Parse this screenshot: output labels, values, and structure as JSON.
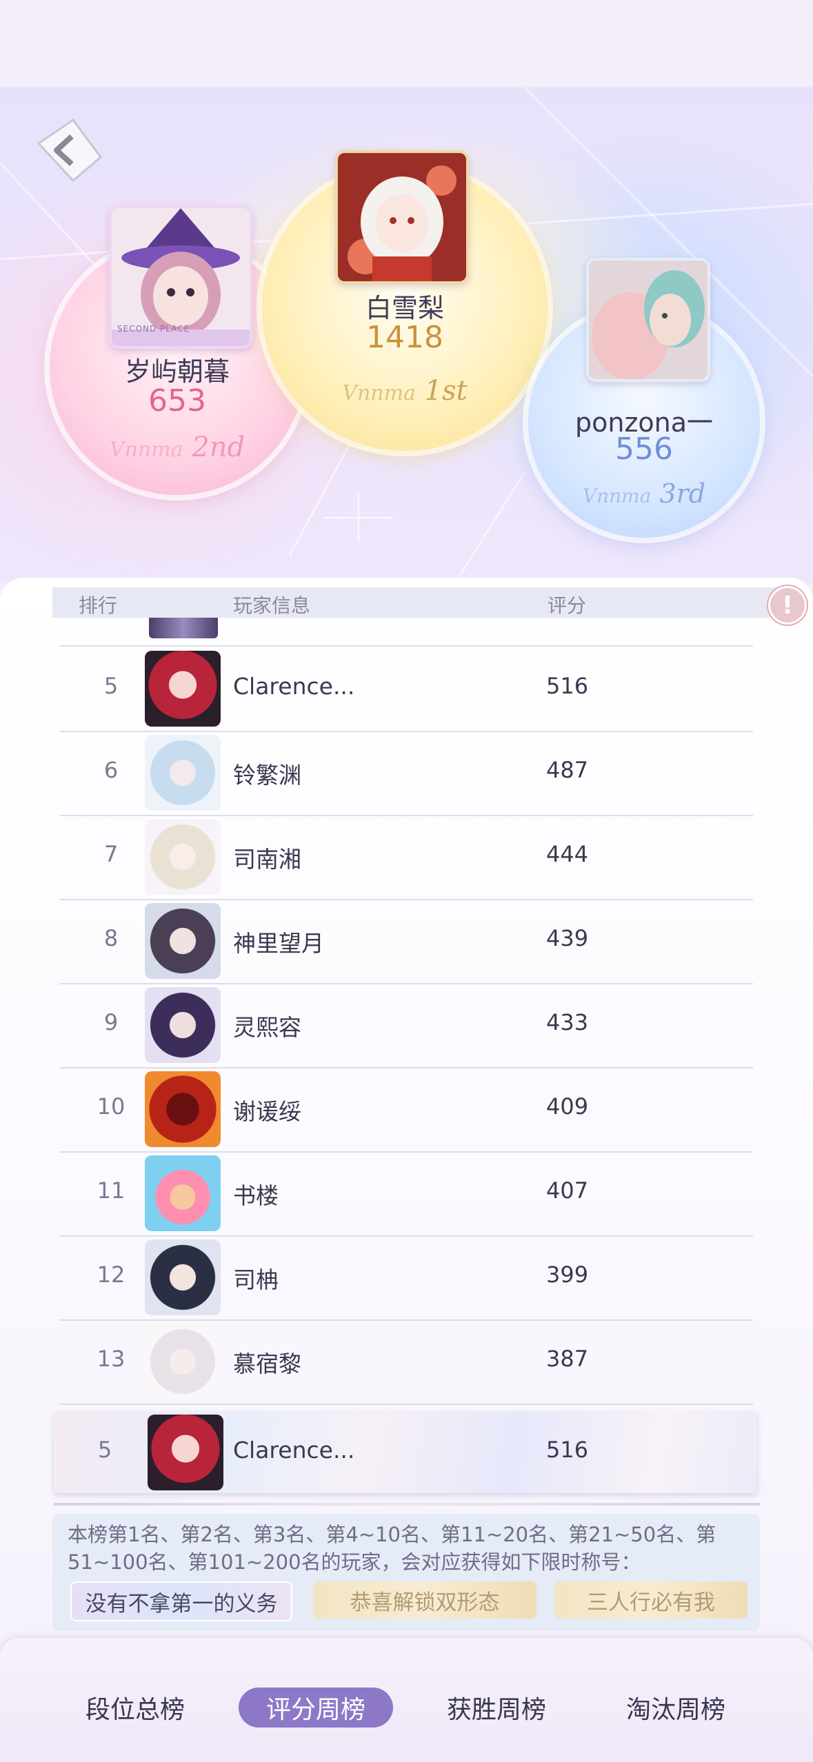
{
  "header": {
    "back_icon": "back-arrow-icon"
  },
  "podium": [
    {
      "place": 2,
      "name": "岁屿朝暮",
      "score": "653",
      "rank_text": "2nd",
      "script_text": "Vnnma"
    },
    {
      "place": 1,
      "name": "白雪梨",
      "score": "1418",
      "rank_text": "1st",
      "script_text": "Vnnma"
    },
    {
      "place": 3,
      "name": "ponzona一",
      "score": "556",
      "rank_text": "3rd",
      "script_text": "Vnnma"
    }
  ],
  "podium_avatar_badge": "SECOND PLACE",
  "table": {
    "columns": {
      "rank": "排行",
      "player": "玩家信息",
      "score": "评分"
    },
    "info_icon": "!",
    "rows": [
      {
        "rank": "5",
        "name": "Clarence...",
        "score": "516"
      },
      {
        "rank": "6",
        "name": "铃繁渊",
        "score": "487"
      },
      {
        "rank": "7",
        "name": "司南湘",
        "score": "444"
      },
      {
        "rank": "8",
        "name": "神里望月",
        "score": "439"
      },
      {
        "rank": "9",
        "name": "灵熙容",
        "score": "433"
      },
      {
        "rank": "10",
        "name": "谢谖绥",
        "score": "409"
      },
      {
        "rank": "11",
        "name": "书楼",
        "score": "407"
      },
      {
        "rank": "12",
        "name": "司柟",
        "score": "399"
      },
      {
        "rank": "13",
        "name": "慕宿黎",
        "score": "387"
      }
    ]
  },
  "my_rank": {
    "rank": "5",
    "name": "Clarence...",
    "score": "516"
  },
  "rewards": {
    "description": "本榜第1名、第2名、第3名、第4~10名、第11~20名、第21~50名、第51~100名、第101~200名的玩家，会对应获得如下限时称号：",
    "titles": [
      "没有不拿第一的义务",
      "恭喜解锁双形态",
      "三人行必有我"
    ]
  },
  "tabs": [
    {
      "label": "段位总榜",
      "active": false
    },
    {
      "label": "评分周榜",
      "active": true
    },
    {
      "label": "获胜周榜",
      "active": false
    },
    {
      "label": "淘汰周榜",
      "active": false
    }
  ],
  "colors": {
    "accent": "#8d78c8",
    "second_score": "#e2658f",
    "first_score": "#c9923a",
    "third_score": "#6f8fd6"
  }
}
